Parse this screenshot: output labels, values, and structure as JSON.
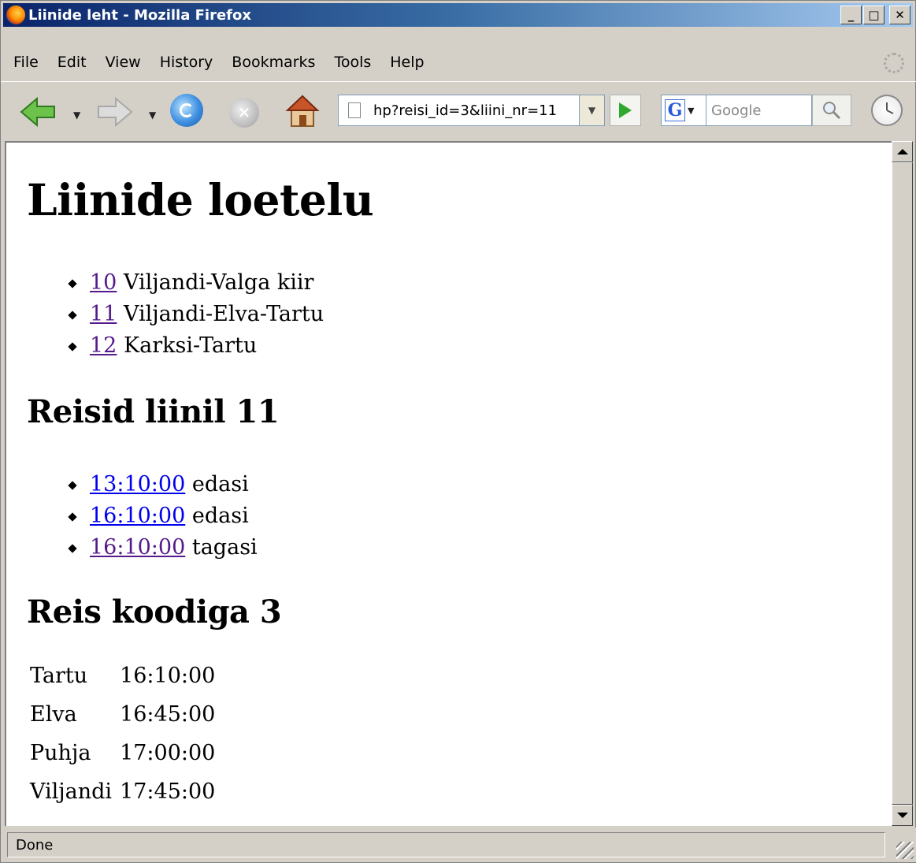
{
  "window": {
    "title": "Liinide leht - Mozilla Firefox",
    "controls": {
      "minimize": "_",
      "maximize": "□",
      "close": "✕"
    }
  },
  "menubar": {
    "items": [
      {
        "label": "File"
      },
      {
        "label": "Edit"
      },
      {
        "label": "View"
      },
      {
        "label": "History"
      },
      {
        "label": "Bookmarks"
      },
      {
        "label": "Tools"
      },
      {
        "label": "Help"
      }
    ]
  },
  "toolbar": {
    "icons": {
      "back": "back-arrow-icon",
      "forward": "forward-arrow-icon",
      "reload": "reload-icon",
      "stop": "stop-icon",
      "home": "home-icon"
    },
    "url": "hp?reisi_id=3&liini_nr=11",
    "search_placeholder": "Google",
    "search_engine": "G"
  },
  "page": {
    "h1": "Liinide loetelu",
    "lines": [
      {
        "number": "10",
        "name": "Viljandi-Valga kiir",
        "visited": true
      },
      {
        "number": "11",
        "name": "Viljandi-Elva-Tartu",
        "visited": true
      },
      {
        "number": "12",
        "name": "Karksi-Tartu",
        "visited": true
      }
    ],
    "trips_heading": "Reisid liinil 11",
    "trips": [
      {
        "time": "13:10:00",
        "direction": "edasi",
        "visited": false
      },
      {
        "time": "16:10:00",
        "direction": "edasi",
        "visited": false
      },
      {
        "time": "16:10:00",
        "direction": "tagasi",
        "visited": true
      }
    ],
    "trip_heading": "Reis koodiga 3",
    "stops": [
      {
        "stop": "Tartu",
        "time": "16:10:00"
      },
      {
        "stop": "Elva",
        "time": "16:45:00"
      },
      {
        "stop": "Puhja",
        "time": "17:00:00"
      },
      {
        "stop": "Viljandi",
        "time": "17:45:00"
      }
    ]
  },
  "status": {
    "text": "Done"
  },
  "colors": {
    "visited_link": "#551a8b",
    "unvisited_link": "#0000ee",
    "titlebar_start": "#0a246a",
    "titlebar_end": "#a6caf0"
  }
}
